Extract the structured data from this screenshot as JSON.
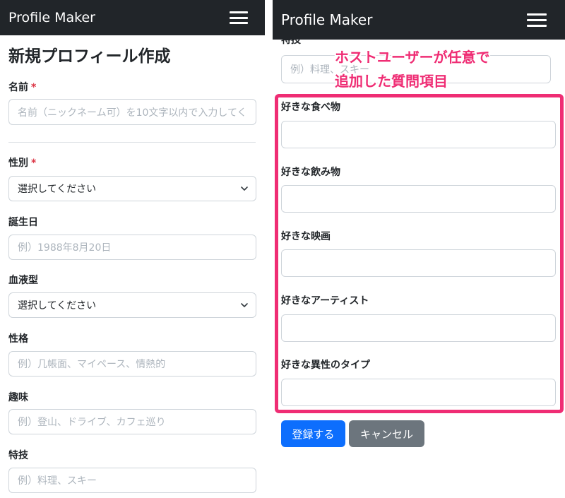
{
  "app": {
    "brand": "Profile Maker"
  },
  "left": {
    "title": "新規プロフィール作成",
    "required_mark": "*",
    "name": {
      "label": "名前",
      "placeholder": "名前（ニックネーム可）を10文字以内で入力してく"
    },
    "gender": {
      "label": "性別",
      "value": "選択してください"
    },
    "birthday": {
      "label": "誕生日",
      "placeholder": "例）1988年8月20日"
    },
    "blood": {
      "label": "血液型",
      "value": "選択してください"
    },
    "personality": {
      "label": "性格",
      "placeholder": "例）几帳面、マイペース、情熱的"
    },
    "hobby": {
      "label": "趣味",
      "placeholder": "例）登山、ドライブ、カフェ巡り"
    },
    "skill": {
      "label": "特技",
      "placeholder": "例）料理、スキー"
    }
  },
  "right": {
    "skill_label_partial": "特技",
    "skill_placeholder": "例）料理、スキー",
    "annotation": {
      "line1": "ホストユーザーが任意で",
      "line2": "追加した質問項目"
    },
    "questions": [
      {
        "label": "好きな食べ物",
        "value": ""
      },
      {
        "label": "好きな飲み物",
        "value": ""
      },
      {
        "label": "好きな映画",
        "value": ""
      },
      {
        "label": "好きなアーティスト",
        "value": ""
      },
      {
        "label": "好きな異性のタイプ",
        "value": ""
      }
    ],
    "submit_label": "登録する",
    "cancel_label": "キャンセル"
  },
  "colors": {
    "navbar": "#212529",
    "required": "#dc3545",
    "highlight": "#ef2d74",
    "primary": "#0d6efd",
    "secondary": "#6c757d"
  }
}
